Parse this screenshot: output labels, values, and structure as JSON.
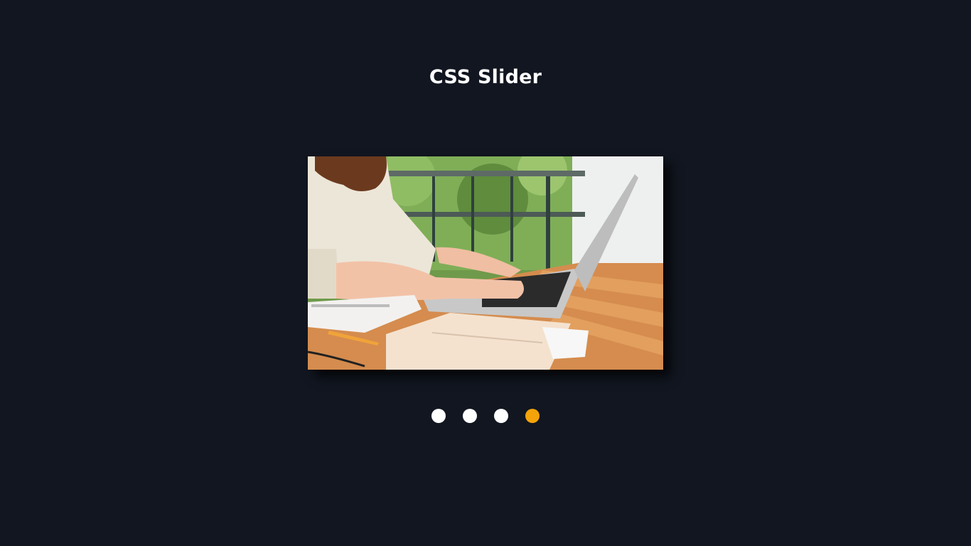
{
  "page": {
    "title": "CSS Slider"
  },
  "slider": {
    "current_slide": 4,
    "slide_count": 4,
    "dots": [
      {
        "active": false
      },
      {
        "active": false
      },
      {
        "active": false
      },
      {
        "active": true
      }
    ]
  },
  "colors": {
    "background": "#111620",
    "title": "#ffffff",
    "dot_inactive": "#ffffff",
    "dot_active": "#f5a30a"
  }
}
